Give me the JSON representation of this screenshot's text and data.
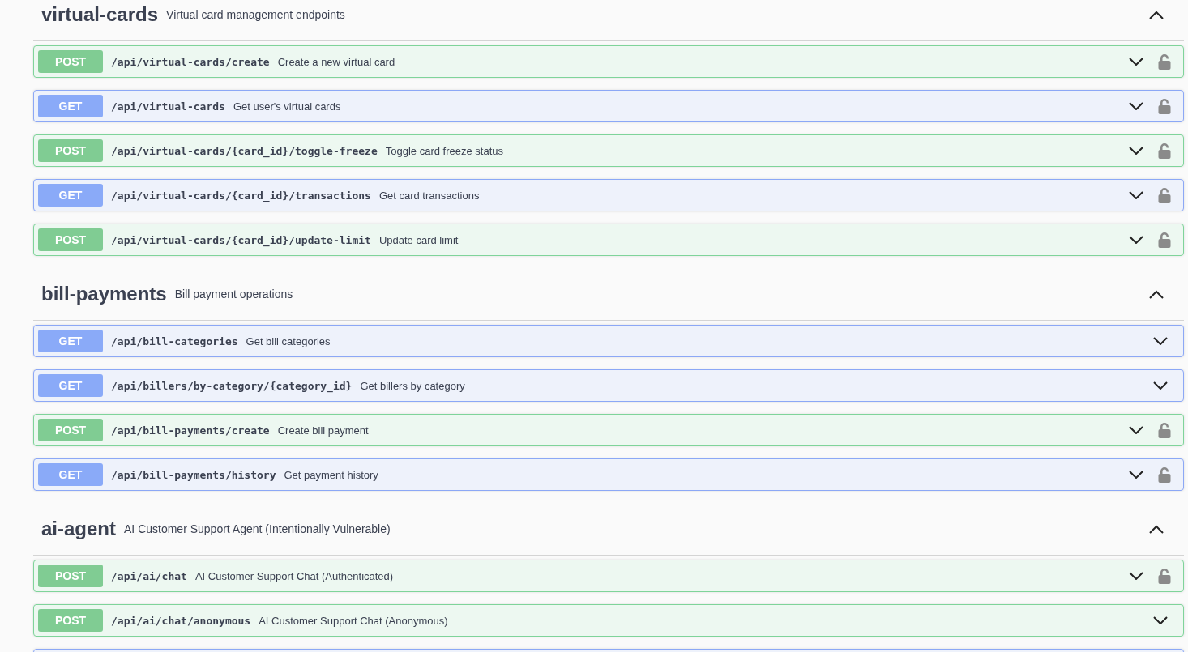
{
  "sections": [
    {
      "name": "virtual-cards",
      "description": "Virtual card management endpoints",
      "expanded": true,
      "operations": [
        {
          "method": "POST",
          "kind": "post",
          "path": "/api/virtual-cards/create",
          "summary": "Create a new virtual card",
          "auth": true
        },
        {
          "method": "GET",
          "kind": "get",
          "path": "/api/virtual-cards",
          "summary": "Get user's virtual cards",
          "auth": true
        },
        {
          "method": "POST",
          "kind": "post",
          "path": "/api/virtual-cards/{card_id}/toggle-freeze",
          "summary": "Toggle card freeze status",
          "auth": true
        },
        {
          "method": "GET",
          "kind": "get",
          "path": "/api/virtual-cards/{card_id}/transactions",
          "summary": "Get card transactions",
          "auth": true
        },
        {
          "method": "POST",
          "kind": "post",
          "path": "/api/virtual-cards/{card_id}/update-limit",
          "summary": "Update card limit",
          "auth": true
        }
      ]
    },
    {
      "name": "bill-payments",
      "description": "Bill payment operations",
      "expanded": true,
      "operations": [
        {
          "method": "GET",
          "kind": "get",
          "path": "/api/bill-categories",
          "summary": "Get bill categories",
          "auth": false
        },
        {
          "method": "GET",
          "kind": "get",
          "path": "/api/billers/by-category/{category_id}",
          "summary": "Get billers by category",
          "auth": false
        },
        {
          "method": "POST",
          "kind": "post",
          "path": "/api/bill-payments/create",
          "summary": "Create bill payment",
          "auth": true
        },
        {
          "method": "GET",
          "kind": "get",
          "path": "/api/bill-payments/history",
          "summary": "Get payment history",
          "auth": true
        }
      ]
    },
    {
      "name": "ai-agent",
      "description": "AI Customer Support Agent (Intentionally Vulnerable)",
      "expanded": true,
      "operations": [
        {
          "method": "POST",
          "kind": "post",
          "path": "/api/ai/chat",
          "summary": "AI Customer Support Chat (Authenticated)",
          "auth": true
        },
        {
          "method": "POST",
          "kind": "post",
          "path": "/api/ai/chat/anonymous",
          "summary": "AI Customer Support Chat (Anonymous)",
          "auth": false
        },
        {
          "kind": "get"
        }
      ]
    }
  ]
}
